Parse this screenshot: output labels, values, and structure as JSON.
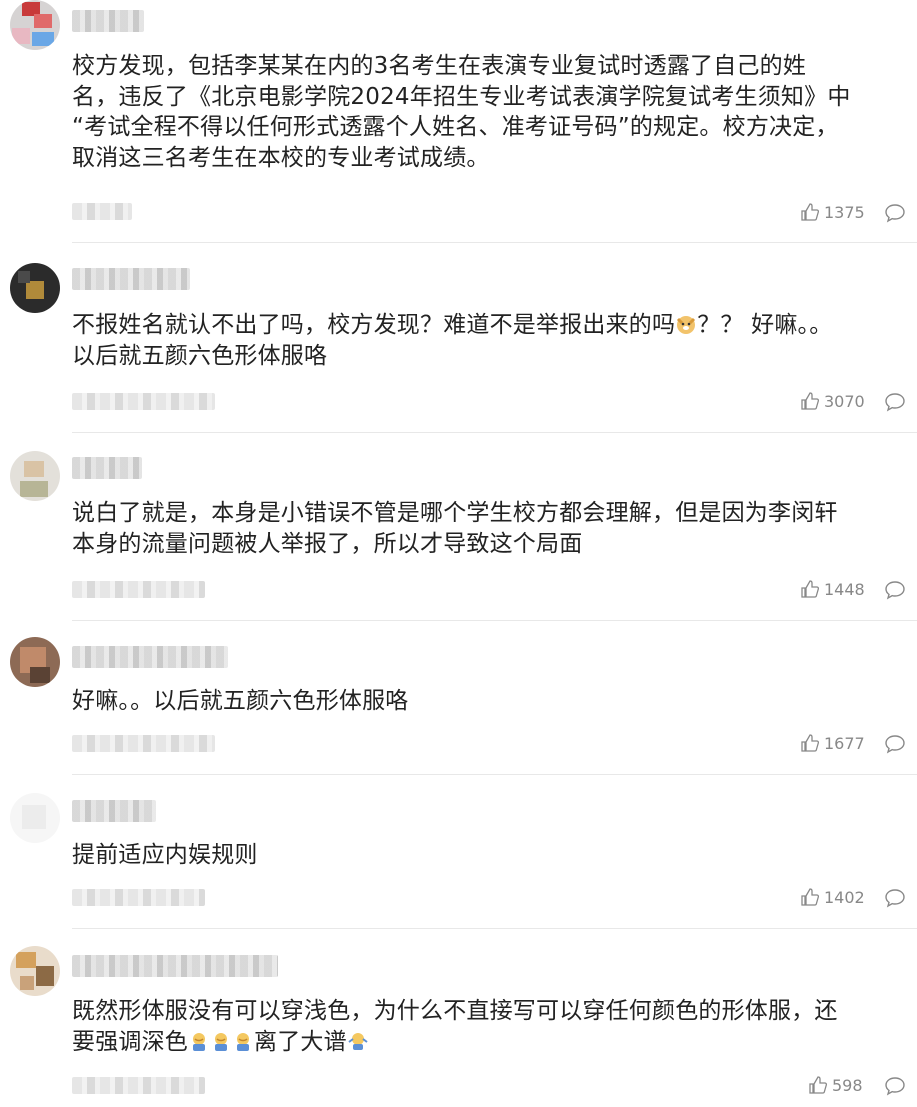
{
  "comments": [
    {
      "text_lines": [
        "校方发现，包括李某某在内的3名考生在表演专业复试时透露了自己的姓",
        "名，违反了《北京电影学院2024年招生专业考试表演学院复试考生须知》中",
        "“考试全程不得以任何形式透露个人姓名、准考证号码”的规定。校方决定，",
        "取消这三名考生在本校的专业考试成绩。"
      ],
      "likes": "1375"
    },
    {
      "text_a": "不报姓名就认不出了吗，校方发现？难道不是举报出来的吗",
      "text_b": "？？ 好嘛。。",
      "text_line2": "以后就五颜六色形体服咯",
      "likes": "3070",
      "emoji": "doge-emoji"
    },
    {
      "text_lines": [
        "说白了就是，本身是小错误不管是哪个学生校方都会理解，但是因为李闵轩",
        "本身的流量问题被人举报了，所以才导致这个局面"
      ],
      "likes": "1448"
    },
    {
      "text_lines": [
        "好嘛。。以后就五颜六色形体服咯"
      ],
      "likes": "1677"
    },
    {
      "text_lines": [
        "提前适应内娱规则"
      ],
      "likes": "1402"
    },
    {
      "text_line1": "既然形体服没有可以穿浅色，为什么不直接写可以穿任何颜色的形体服，还",
      "text_a": "要强调深色",
      "text_b": "离了大谱",
      "likes": "598",
      "emoji": "facepalm-emoji",
      "emoji_end": "shrug-emoji"
    }
  ],
  "colors": {
    "text": "#222222",
    "meta": "#888888",
    "divider": "#e8e8e8"
  }
}
